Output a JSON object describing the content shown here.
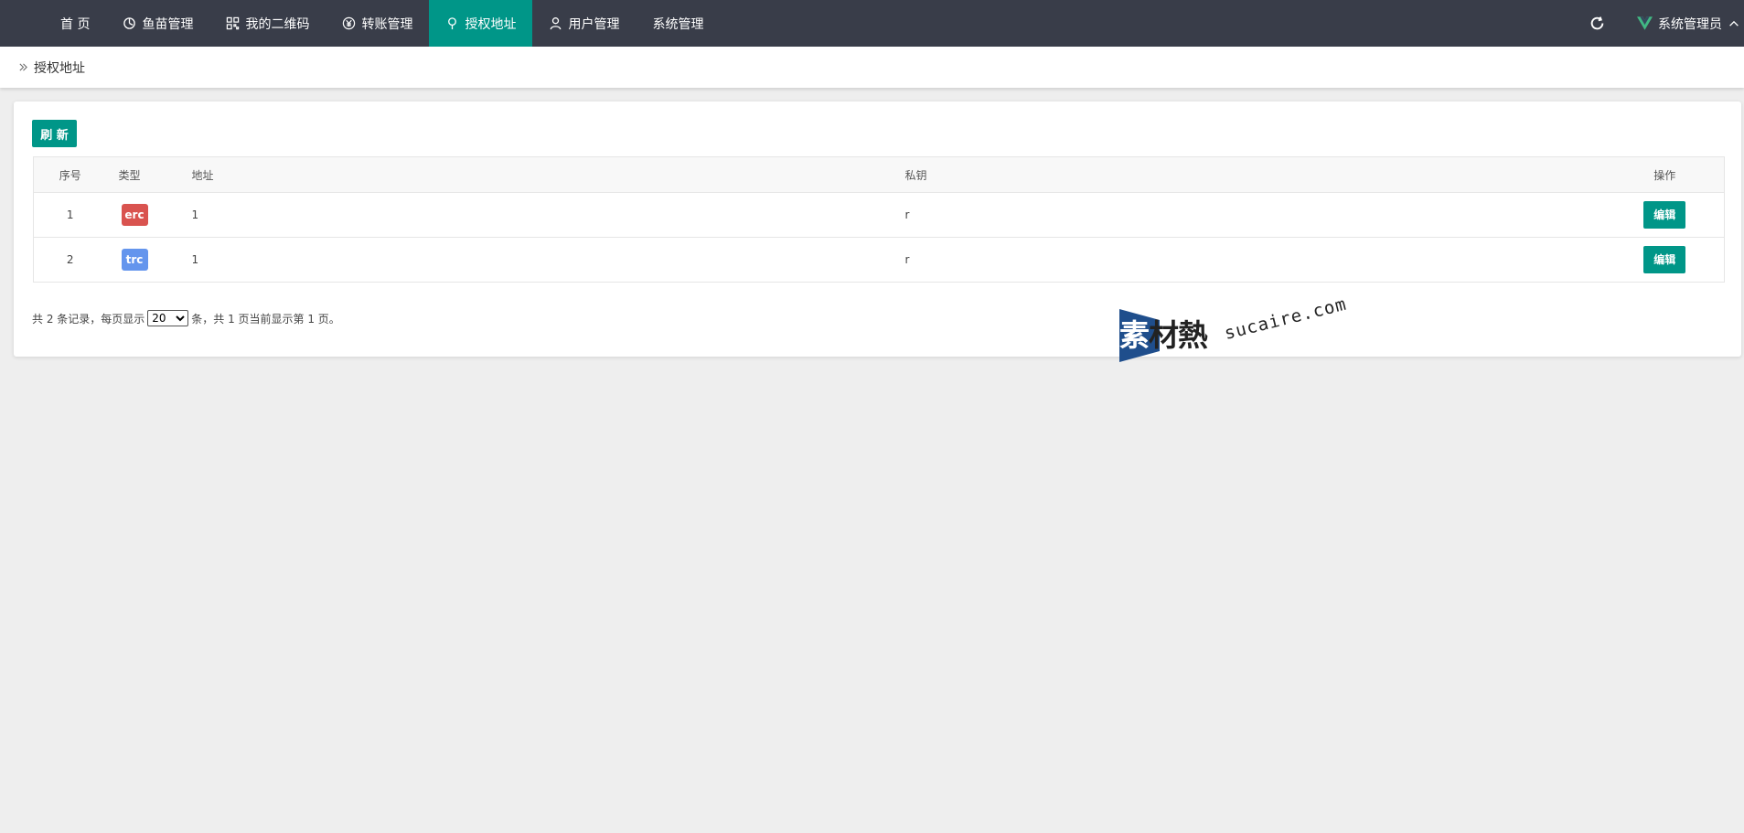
{
  "nav": {
    "items": [
      {
        "label": "首 页",
        "icon": "none"
      },
      {
        "label": "鱼苗管理",
        "icon": "fish-icon"
      },
      {
        "label": "我的二维码",
        "icon": "qrcode-icon"
      },
      {
        "label": "转账管理",
        "icon": "yen-icon"
      },
      {
        "label": "授权地址",
        "icon": "location-pin-icon",
        "active": true
      },
      {
        "label": "用户管理",
        "icon": "user-icon"
      },
      {
        "label": "系统管理",
        "icon": "none"
      }
    ],
    "user": "系统管理员"
  },
  "breadcrumb": {
    "current": "授权地址"
  },
  "toolbar": {
    "refresh_label": "刷 新"
  },
  "table": {
    "headers": {
      "index": "序号",
      "type": "类型",
      "address": "地址",
      "private_key": "私钥",
      "actions": "操作"
    },
    "rows": [
      {
        "index": "1",
        "type": "erc",
        "type_color": "#d9534f",
        "address": "1",
        "private_key": "r",
        "action": "编辑"
      },
      {
        "index": "2",
        "type": "trc",
        "type_color": "#6495ed",
        "address": "1",
        "private_key": "r",
        "action": "编辑"
      }
    ]
  },
  "pager": {
    "prefix": "共 2 条记录，每页显示",
    "page_size": "20",
    "suffix": "条，共 1 页当前显示第 1 页。"
  },
  "watermark": {
    "brand": "素材熱",
    "url": "sucaire.com"
  },
  "colors": {
    "nav_bg": "#393d49",
    "accent": "#009688",
    "page_bg": "#eeeeee"
  }
}
